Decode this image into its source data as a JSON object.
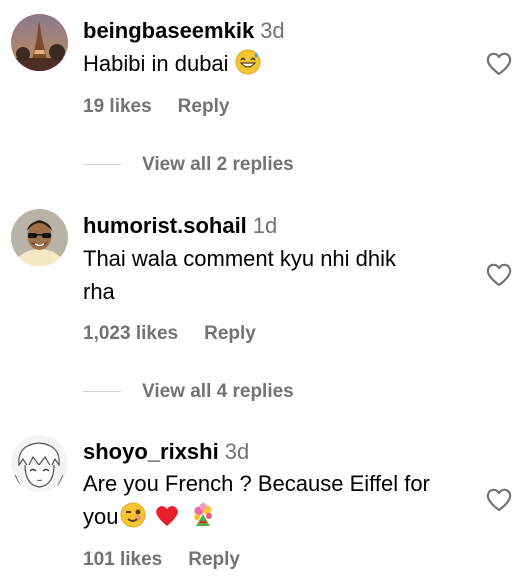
{
  "comments": [
    {
      "username": "beingbaseemkik",
      "age": "3d",
      "text_lines": [
        "Habibi in dubai"
      ],
      "emojis": [
        "grinning-sweat-emoji"
      ],
      "likes": "19 likes",
      "reply": "Reply",
      "view_replies": "View all 2 replies"
    },
    {
      "username": "humorist.sohail",
      "age": "1d",
      "text_lines": [
        "Thai wala comment kyu nhi dhik",
        "rha"
      ],
      "emojis": [],
      "likes": "1,023 likes",
      "reply": "Reply",
      "view_replies": "View all 4 replies"
    },
    {
      "username": "shoyo_rixshi",
      "age": "3d",
      "text_lines": [
        "Are you French ? Because Eiffel for",
        "you"
      ],
      "emojis": [
        "winking-face-emoji",
        "red-heart-emoji",
        "bouquet-emoji"
      ],
      "likes": "101 likes",
      "reply": "Reply"
    }
  ],
  "colors": {
    "muted": "#737373",
    "heart_red": "#e8202e",
    "emoji_yellow": "#f7c531"
  },
  "icons": [
    "heart-icon",
    "avatar"
  ]
}
